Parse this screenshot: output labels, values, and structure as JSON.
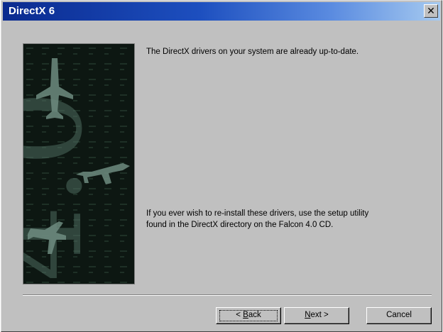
{
  "window": {
    "title": "DirectX 6",
    "close_glyph": "✕"
  },
  "banner": {
    "logo_text": "4.0",
    "icon": "falcon-4-jet-banner"
  },
  "messages": {
    "status": "The DirectX drivers on your system are already up-to-date.",
    "reinstall_line1": "If you ever wish to re-install these drivers, use the setup utility",
    "reinstall_line2": "found in the DirectX directory on the Falcon 4.0 CD."
  },
  "buttons": {
    "back": {
      "prefix": "< ",
      "accel": "B",
      "rest": "ack"
    },
    "next": {
      "accel": "N",
      "rest": "ext >"
    },
    "cancel": "Cancel"
  },
  "colors": {
    "dialog_face": "#c0c0c0",
    "title_start": "#0a2a8f",
    "title_end": "#a6caf0",
    "banner_bg": "#0d1712"
  }
}
